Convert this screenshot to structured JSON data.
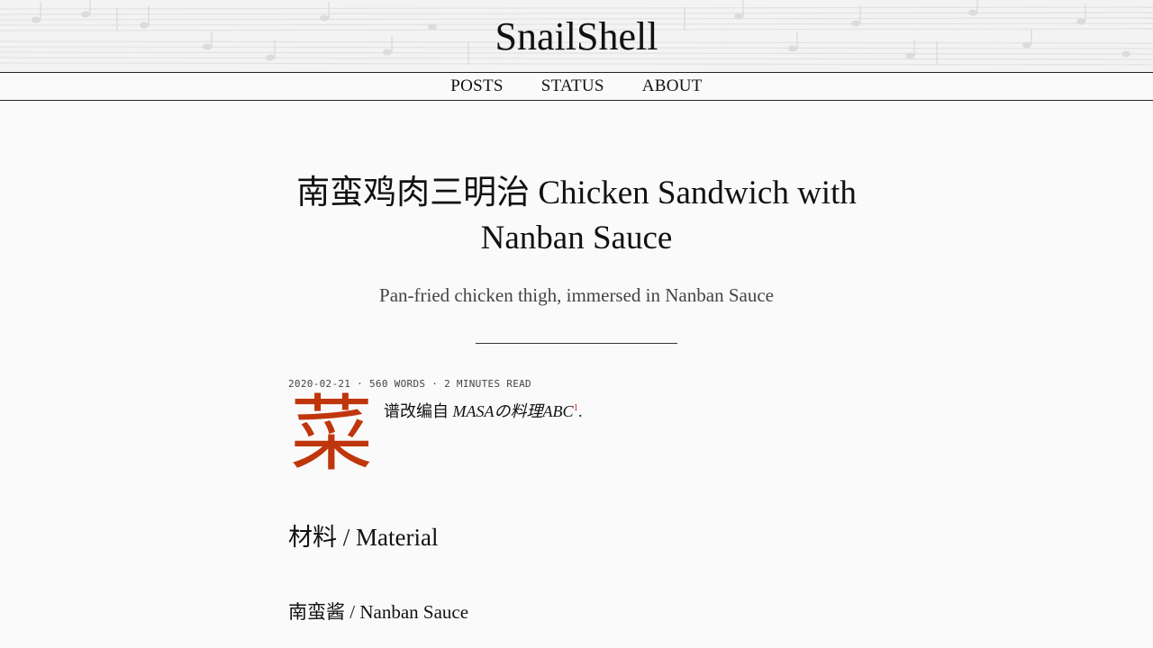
{
  "site": {
    "title": "SnailShell"
  },
  "nav": {
    "items": [
      {
        "label": "POSTS"
      },
      {
        "label": "STATUS"
      },
      {
        "label": "ABOUT"
      }
    ]
  },
  "post": {
    "title": "南蛮鸡肉三明治 Chicken Sandwich with Nanban Sauce",
    "subtitle": "Pan-fried chicken thigh, immersed in Nanban Sauce",
    "meta": "2020-02-21 · 560 WORDS · 2 MINUTES READ",
    "dropcap": "菜",
    "intro_prefix": "谱改编自 ",
    "intro_source": "MASAの料理ABC",
    "intro_footnote": "1",
    "intro_suffix": ".",
    "section_heading": "材料 / Material",
    "subsection_heading": "南蛮酱 / Nanban Sauce"
  },
  "colors": {
    "accent": "#c0360c",
    "background": "#fafafa",
    "text": "#111111"
  }
}
